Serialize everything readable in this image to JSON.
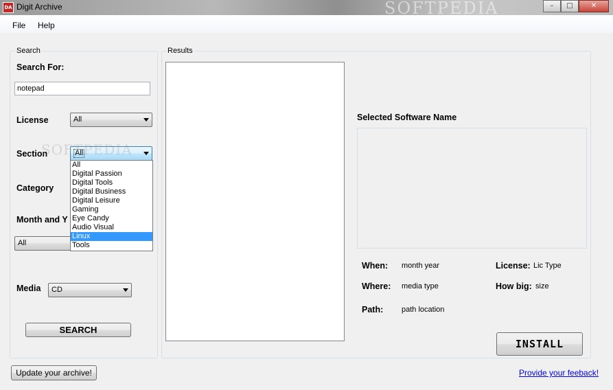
{
  "window": {
    "title": "Digit Archive",
    "icon": "app-logo-icon",
    "titlebar_watermark": "SOFTPEDIA",
    "controls": {
      "minimize": "minimize-icon",
      "maximize": "maximize-icon",
      "close": "close-icon"
    }
  },
  "menu": {
    "items": [
      "File",
      "Help"
    ]
  },
  "search": {
    "group_label": "Search",
    "search_for_label": "Search For:",
    "search_for_value": "notepad",
    "license_label": "License",
    "license_value": "All",
    "section_label": "Section",
    "section_value": "All",
    "category_label": "Category",
    "month_label": "Month and Y",
    "month_value": "All",
    "media_label": "Media",
    "media_value": "CD",
    "search_button": "SEARCH",
    "section_options": [
      "All",
      "Digital Passion",
      "Digital Tools",
      "Digital Business",
      "Digital Leisure",
      "Gaming",
      "Eye Candy",
      "Audio Visual",
      "Linux",
      "Tools"
    ],
    "section_highlighted": "Linux"
  },
  "results": {
    "group_label": "Results",
    "selected_name": "Selected Software Name",
    "when_label": "When:",
    "when_value": "month  year",
    "where_label": "Where:",
    "where_value": "media type",
    "path_label": "Path:",
    "path_value": "path location",
    "license_label": "License:",
    "license_value": "Lic Type",
    "howbig_label": "How big:",
    "howbig_value": "size",
    "install_button": "INSTALL"
  },
  "footer": {
    "update_button": "Update your archive!",
    "feedback_link": "Provide your feeback!"
  },
  "watermark": "SOFTPEDIA"
}
